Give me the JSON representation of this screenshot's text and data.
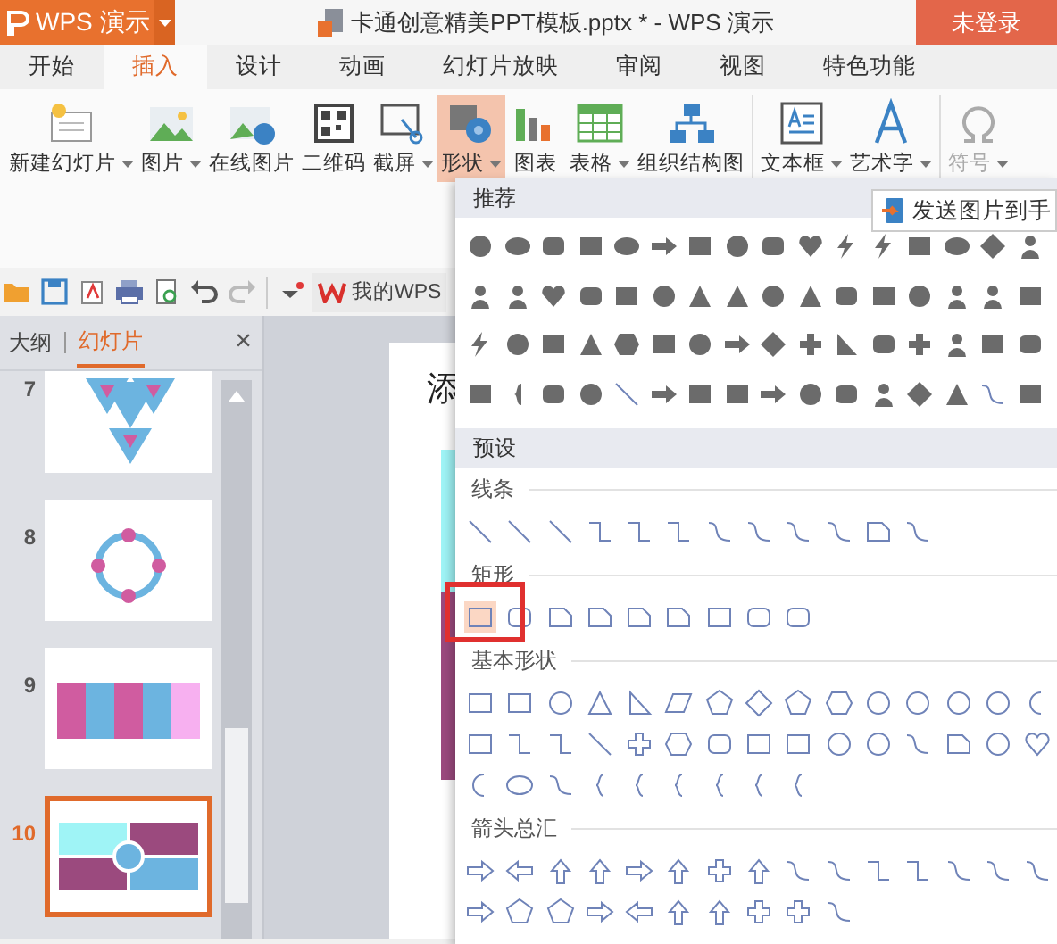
{
  "title_bar": {
    "app_menu": "WPS 演示",
    "file_title": "卡通创意精美PPT模板.pptx * - WPS 演示",
    "login_button": "未登录"
  },
  "tabs": [
    {
      "label": "开始",
      "selected": false
    },
    {
      "label": "插入",
      "selected": true
    },
    {
      "label": "设计",
      "selected": false
    },
    {
      "label": "动画",
      "selected": false
    },
    {
      "label": "幻灯片放映",
      "selected": false
    },
    {
      "label": "审阅",
      "selected": false
    },
    {
      "label": "视图",
      "selected": false
    },
    {
      "label": "特色功能",
      "selected": false
    }
  ],
  "ribbon": [
    {
      "label": "新建幻灯片",
      "kind": "new-slide",
      "dropdown": true,
      "selected": false,
      "disabled": false
    },
    {
      "label": "图片",
      "kind": "picture",
      "dropdown": true,
      "selected": false,
      "disabled": false
    },
    {
      "label": "在线图片",
      "kind": "online-picture",
      "dropdown": false,
      "selected": false,
      "disabled": false
    },
    {
      "label": "二维码",
      "kind": "qr",
      "dropdown": false,
      "selected": false,
      "disabled": false
    },
    {
      "label": "截屏",
      "kind": "screenshot",
      "dropdown": true,
      "selected": false,
      "disabled": false
    },
    {
      "label": "形状",
      "kind": "shapes",
      "dropdown": true,
      "selected": true,
      "disabled": false
    },
    {
      "label": "图表",
      "kind": "chart",
      "dropdown": false,
      "selected": false,
      "disabled": false
    },
    {
      "label": "表格",
      "kind": "table",
      "dropdown": true,
      "selected": false,
      "disabled": false
    },
    {
      "label": "组织结构图",
      "kind": "org",
      "dropdown": false,
      "selected": false,
      "disabled": false
    },
    {
      "label": "文本框",
      "kind": "textbox",
      "dropdown": true,
      "selected": false,
      "disabled": false
    },
    {
      "label": "艺术字",
      "kind": "wordart",
      "dropdown": true,
      "selected": false,
      "disabled": false
    },
    {
      "label": "符号",
      "kind": "symbol",
      "dropdown": true,
      "selected": false,
      "disabled": true
    }
  ],
  "quick_bar": {
    "wps_tab": "我的WPS"
  },
  "side_panel": {
    "tabs": [
      {
        "label": "大纲",
        "selected": false
      },
      {
        "label": "幻灯片",
        "selected": true
      }
    ],
    "close": "×",
    "slides": [
      {
        "number": "7",
        "kind": "triangles",
        "selected": false
      },
      {
        "number": "8",
        "kind": "ring",
        "selected": false
      },
      {
        "number": "9",
        "kind": "columns",
        "selected": false
      },
      {
        "number": "10",
        "kind": "quadrants",
        "selected": true
      }
    ]
  },
  "slide": {
    "title": "添"
  },
  "shape_menu": {
    "recommended": {
      "title": "推荐"
    },
    "presets": {
      "title": "预设",
      "sections": [
        {
          "title": "线条"
        },
        {
          "title": "矩形",
          "shapes": [
            {
              "selected": true
            },
            {
              "selected": false
            },
            {
              "selected": false
            },
            {
              "selected": false
            },
            {
              "selected": false
            },
            {
              "selected": false
            },
            {
              "selected": false
            },
            {
              "selected": false
            },
            {
              "selected": false
            }
          ]
        },
        {
          "title": "基本形状"
        },
        {
          "title": "箭头总汇"
        }
      ]
    }
  },
  "tooltip": "发送图片到手"
}
